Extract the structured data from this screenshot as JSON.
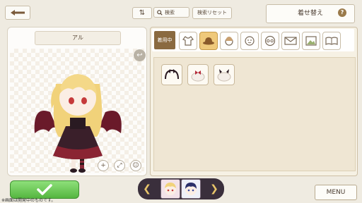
{
  "header": {
    "search_label": "検索",
    "reset_label": "検索リセット",
    "title": "着せ替え",
    "help_symbol": "?"
  },
  "preview": {
    "character_name": "アル"
  },
  "categories": {
    "equipped_label": "着用中",
    "items": [
      "costume-icon",
      "hat-icon",
      "hair-icon",
      "face-icon",
      "glasses-icon",
      "envelope-icon",
      "frame-icon",
      "book-icon"
    ],
    "active_index": 1
  },
  "items": [
    "bow-headdress",
    "ribbon-hair",
    "horned-headband"
  ],
  "footer": {
    "note": "※画面は開発中のものです。",
    "menu_label": "MENU"
  },
  "colors": {
    "accent_brown": "#8a6a40",
    "ok_green": "#55b640",
    "active_category": "#efc97b"
  }
}
